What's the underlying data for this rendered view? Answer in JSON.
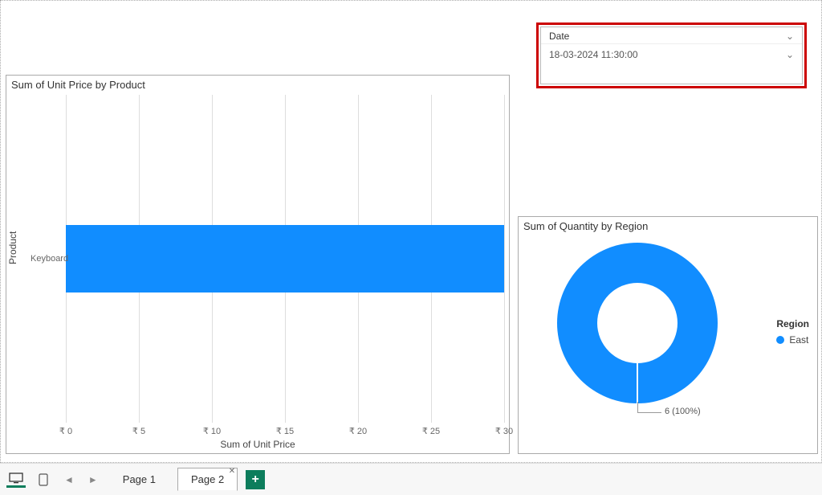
{
  "slicer": {
    "field_label": "Date",
    "value": "18-03-2024 11:30:00"
  },
  "bar_chart": {
    "title": "Sum of Unit Price by Product",
    "y_axis_title": "Product",
    "x_axis_title": "Sum of Unit Price",
    "x_ticks": [
      "₹ 0",
      "₹ 5",
      "₹ 10",
      "₹ 15",
      "₹ 20",
      "₹ 25",
      "₹ 30"
    ],
    "category_label": "Keyboard"
  },
  "donut_chart": {
    "title": "Sum of Quantity by Region",
    "legend_title": "Region",
    "legend_item": "East",
    "data_label": "6 (100%)"
  },
  "tabs": {
    "page1": "Page 1",
    "page2": "Page 2"
  },
  "chart_data": [
    {
      "type": "bar",
      "orientation": "horizontal",
      "title": "Sum of Unit Price by Product",
      "xlabel": "Sum of Unit Price",
      "ylabel": "Product",
      "categories": [
        "Keyboard"
      ],
      "values": [
        30
      ],
      "xlim": [
        0,
        30
      ],
      "x_tick_interval": 5,
      "currency_prefix": "₹",
      "series_color": "#118dff"
    },
    {
      "type": "donut",
      "title": "Sum of Quantity by Region",
      "legend_title": "Region",
      "series": [
        {
          "name": "East",
          "value": 6,
          "percent": 100,
          "color": "#118dff"
        }
      ]
    }
  ]
}
